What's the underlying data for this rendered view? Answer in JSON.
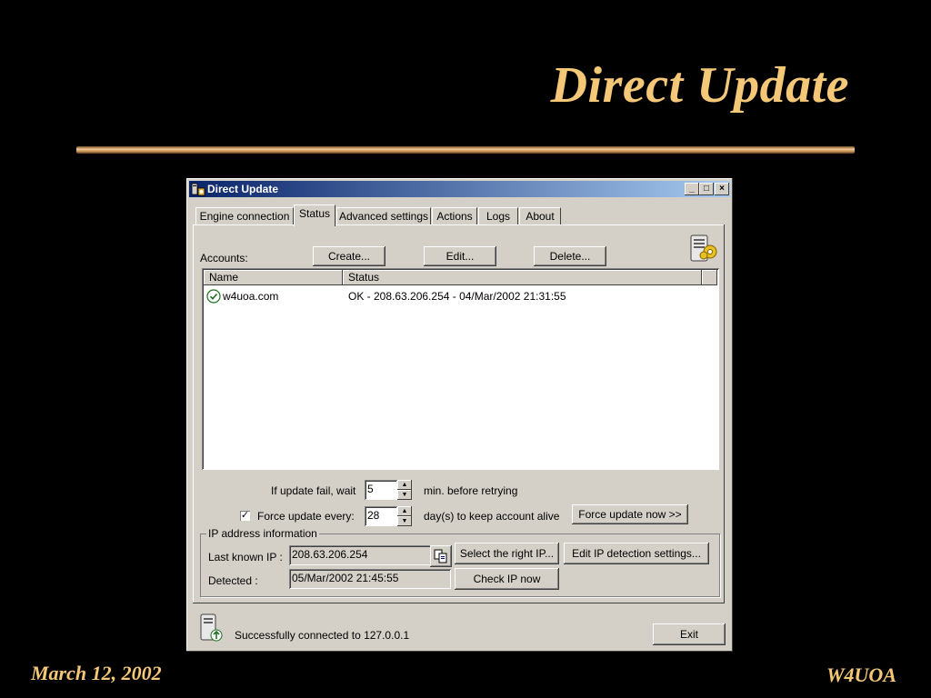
{
  "slide": {
    "title": "Direct Update",
    "footer_left": "March 12, 2002",
    "footer_right": "W4UOA"
  },
  "window": {
    "title": "Direct Update",
    "controls": {
      "minimize": "_",
      "maximize": "□",
      "close": "×"
    }
  },
  "tabs": [
    {
      "label": "Engine connection"
    },
    {
      "label": "Status"
    },
    {
      "label": "Advanced settings"
    },
    {
      "label": "Actions"
    },
    {
      "label": "Logs"
    },
    {
      "label": "About"
    }
  ],
  "accounts": {
    "label": "Accounts:",
    "create_label": "Create...",
    "edit_label": "Edit...",
    "delete_label": "Delete...",
    "columns": [
      "Name",
      "Status"
    ],
    "rows": [
      {
        "name": "w4uoa.com",
        "status": "OK - 208.63.206.254 - 04/Mar/2002 21:31:55",
        "icon": "check-circle-icon"
      }
    ]
  },
  "retry": {
    "label": "If update fail, wait",
    "value": "5",
    "suffix": "min.  before retrying"
  },
  "force": {
    "checked": true,
    "label": "Force update every:",
    "value": "28",
    "suffix": "day(s) to keep account alive",
    "button_label": "Force update now >>"
  },
  "ip_info": {
    "group_title": "IP address information",
    "last_known_label": "Last known IP :",
    "last_known_value": "208.63.206.254",
    "detected_label": "Detected :",
    "detected_value": "05/Mar/2002 21:45:55",
    "select_ip_label": "Select the right IP...",
    "edit_detection_label": "Edit IP detection settings...",
    "check_ip_label": "Check IP now"
  },
  "status_bar": {
    "message": "Successfully connected to 127.0.0.1",
    "exit_label": "Exit"
  },
  "colors": {
    "slide_accent": "#f5c878",
    "title_bar": "#0a246a",
    "window_bg": "#d4d0c8"
  }
}
